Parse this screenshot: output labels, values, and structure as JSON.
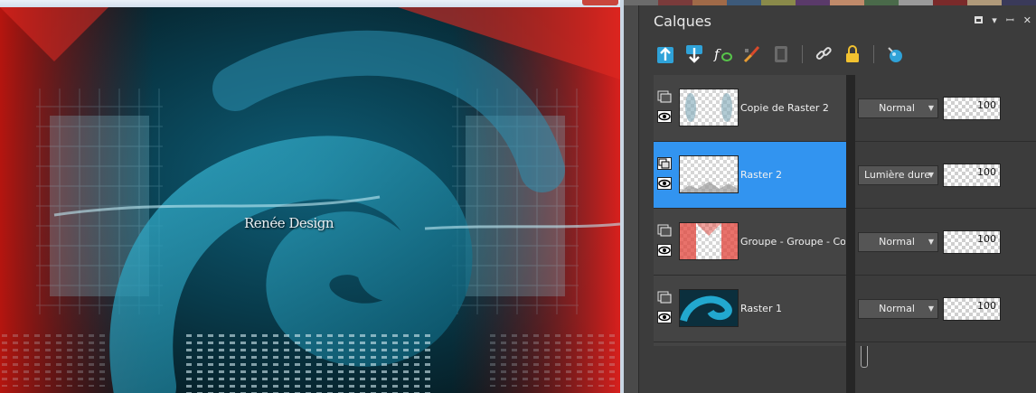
{
  "canvas": {
    "watermark": "Renée Design"
  },
  "palette": {
    "title": "Calques",
    "title_controls": [
      "maximize-icon",
      "dropdown-icon",
      "pin-icon",
      "close-icon"
    ],
    "toolbar_icons": [
      "new-raster-layer-icon",
      "new-vector-layer-icon",
      "fx-effects-icon",
      "paint-brush-icon",
      "mask-icon",
      "link-icon",
      "lock-icon",
      "properties-icon"
    ],
    "layers": [
      {
        "name": "Copie de Raster 2",
        "blend": "Normal",
        "opacity": "100",
        "selected": false
      },
      {
        "name": "Raster 2",
        "blend": "Lumière dure",
        "opacity": "100",
        "selected": true
      },
      {
        "name": "Groupe - Groupe - Copie",
        "blend": "Normal",
        "opacity": "100",
        "selected": false
      },
      {
        "name": "Raster 1",
        "blend": "Normal",
        "opacity": "100",
        "selected": false
      }
    ]
  },
  "colors": {
    "selection": "#3294f0",
    "panel": "#3c3c3c",
    "accent_red": "#d8201d",
    "accent_teal": "#1d8fae"
  }
}
